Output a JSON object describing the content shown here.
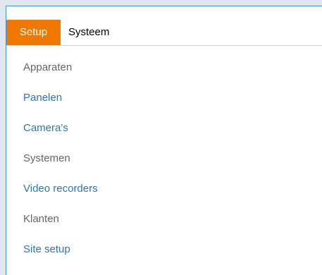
{
  "header": {
    "tab_label": "Setup",
    "title": "Systeem"
  },
  "menu": {
    "items": [
      {
        "label": "Apparaten",
        "kind": "group"
      },
      {
        "label": "Panelen",
        "kind": "link"
      },
      {
        "label": "Camera's",
        "kind": "link"
      },
      {
        "label": "Systemen",
        "kind": "group"
      },
      {
        "label": "Video recorders",
        "kind": "link"
      },
      {
        "label": "Klanten",
        "kind": "group"
      },
      {
        "label": "Site setup",
        "kind": "link"
      }
    ]
  },
  "colors": {
    "accent": "#f07800",
    "link": "#2e75b6",
    "group_text": "#666666",
    "border": "#4d90c8"
  }
}
